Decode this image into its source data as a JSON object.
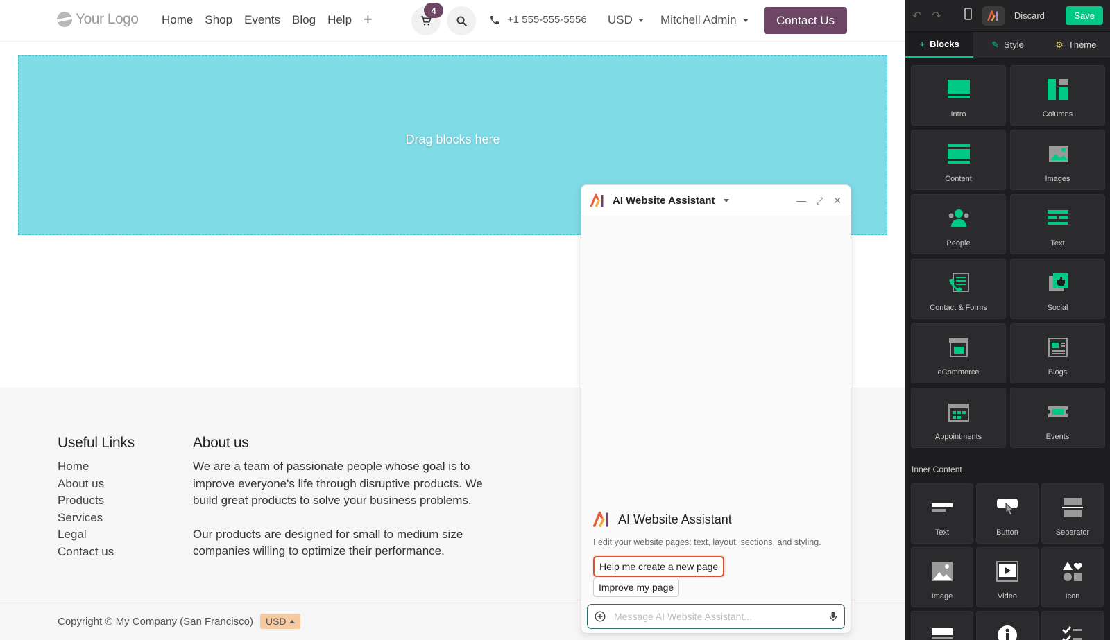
{
  "header": {
    "logo_text": "Your Logo",
    "nav": [
      "Home",
      "Shop",
      "Events",
      "Blog",
      "Help"
    ],
    "nav_add": "+",
    "cart_count": "4",
    "phone": "+1 555-555-5556",
    "currency": "USD",
    "user": "Mitchell Admin",
    "contact_label": "Contact Us"
  },
  "main": {
    "dropzone_label": "Drag blocks here"
  },
  "footer": {
    "links_title": "Useful Links",
    "links": [
      "Home",
      "About us",
      "Products",
      "Services",
      "Legal",
      "Contact us"
    ],
    "about_title": "About us",
    "about_p1": "We are a team of passionate people whose goal is to improve everyone's life through disruptive products. We build great products to solve your business problems.",
    "about_p2": "Our products are designed for small to medium size companies willing to optimize their performance.",
    "copyright": "Copyright © My Company (San Francisco)",
    "currency_chip": "USD"
  },
  "assistant": {
    "title": "AI Website Assistant",
    "intro_title": "AI Website Assistant",
    "intro_desc": "I edit your website pages: text, layout, sections, and styling.",
    "suggestions": [
      "Help me create a new page",
      "Improve my page"
    ],
    "input_placeholder": "Message AI Website Assistant..."
  },
  "editor": {
    "discard": "Discard",
    "save": "Save",
    "tabs": [
      "Blocks",
      "Style",
      "Theme"
    ],
    "blocks": [
      "Intro",
      "Columns",
      "Content",
      "Images",
      "People",
      "Text",
      "Contact & Forms",
      "Social",
      "eCommerce",
      "Blogs",
      "Appointments",
      "Events"
    ],
    "inner_title": "Inner Content",
    "inner_blocks": [
      "Text",
      "Button",
      "Separator",
      "Image",
      "Video",
      "Icon",
      "",
      "",
      ""
    ]
  },
  "colors": {
    "brand": "#6c4664",
    "accent": "#00c986",
    "dropzone": "#7fdbe6",
    "highlight": "#d9532c"
  }
}
